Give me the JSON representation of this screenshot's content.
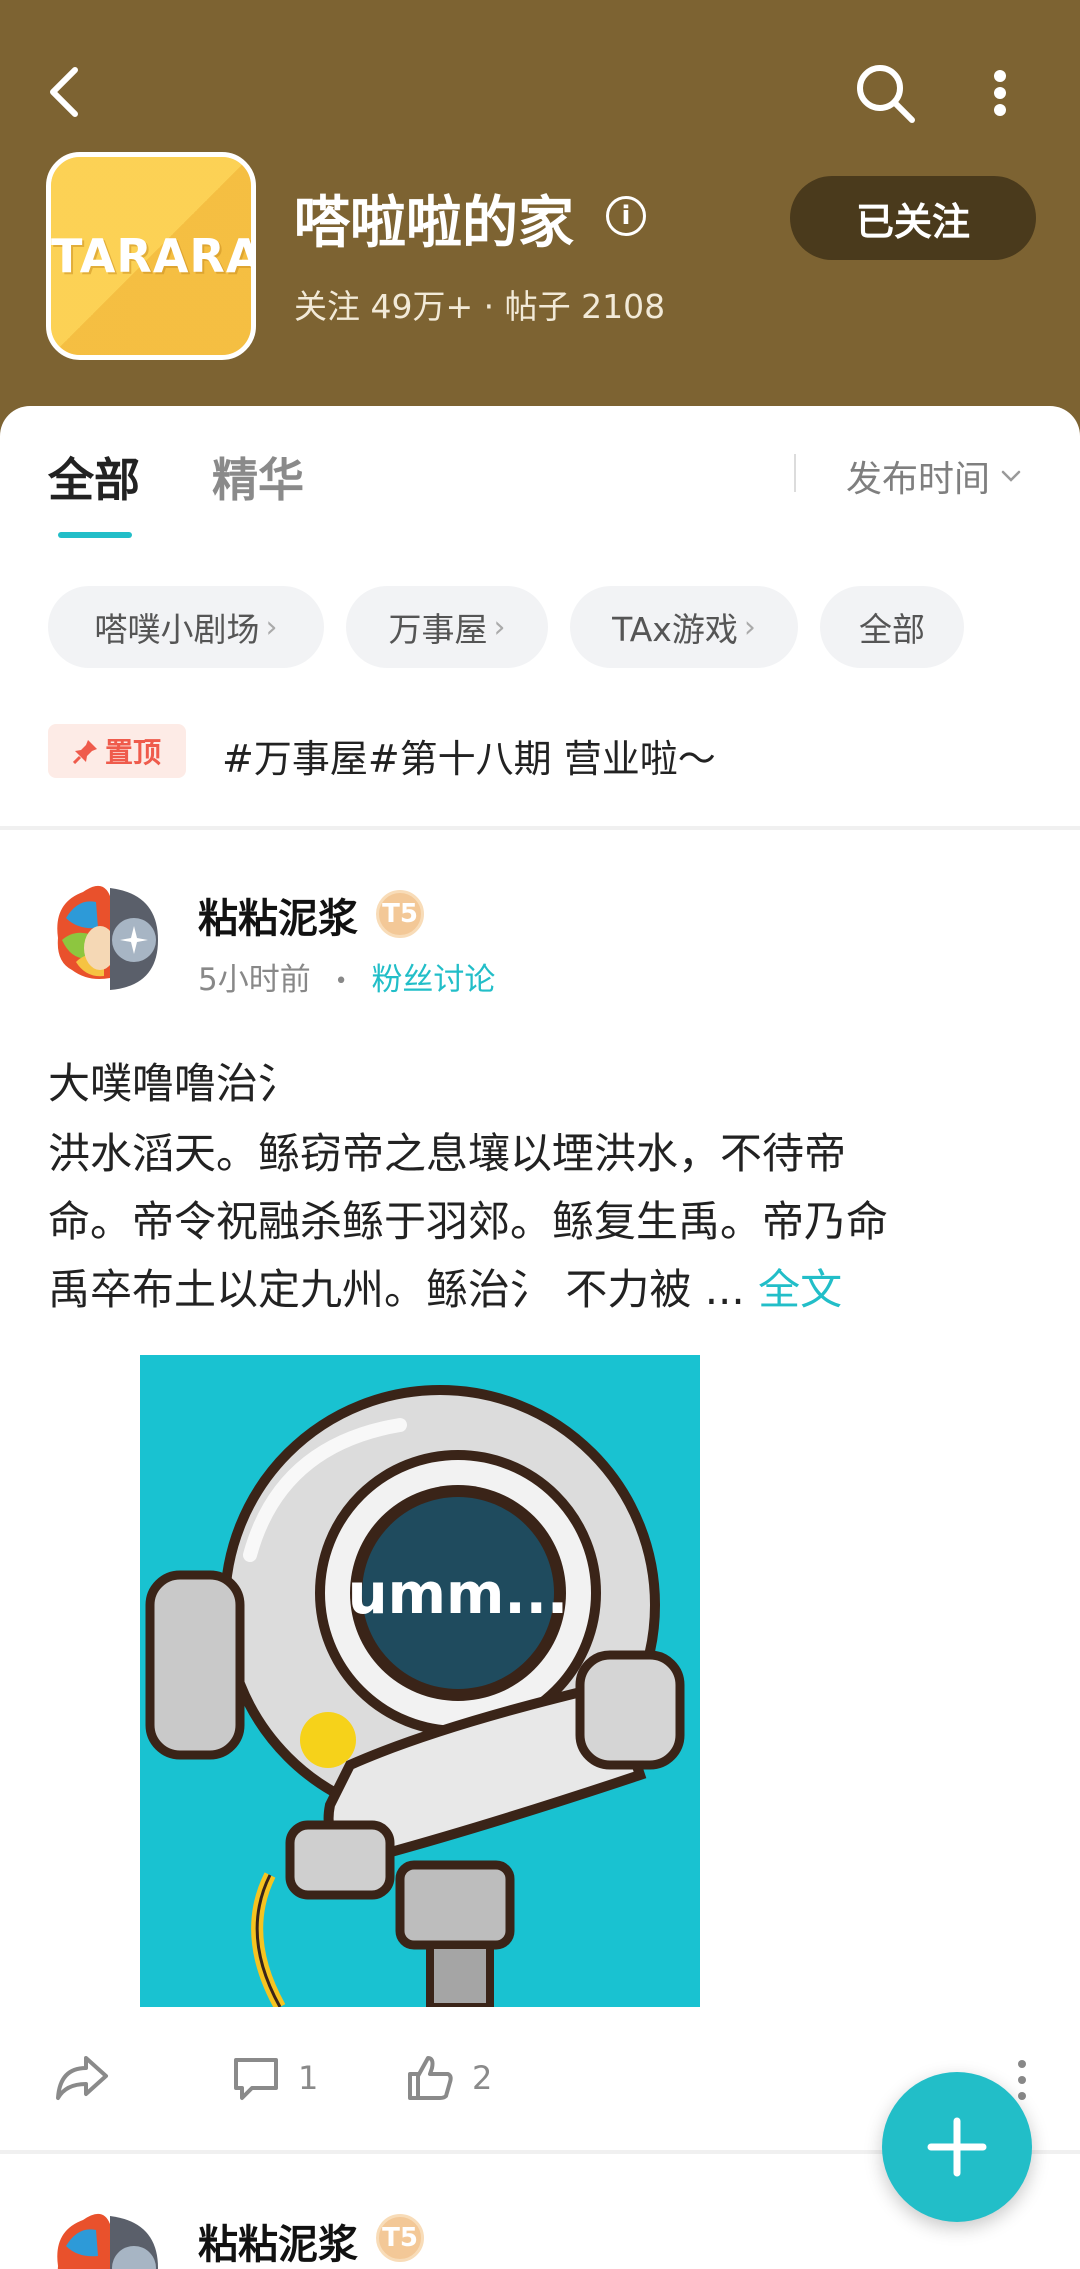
{
  "colors": {
    "header_bg": "#7d6332",
    "accent": "#22bec8",
    "pin_red": "#ef5b4c"
  },
  "header": {
    "logo_text": "TARARA",
    "title": "嗒啦啦的家",
    "stats": "关注 49万+ · 帖子 2108",
    "follow_label": "已关注"
  },
  "icons": [
    "back-icon",
    "search-icon",
    "more-vertical-icon",
    "info-icon",
    "pin-icon",
    "share-icon",
    "comment-icon",
    "like-icon",
    "plus-icon"
  ],
  "tabs": [
    {
      "label": "全部",
      "active": true
    },
    {
      "label": "精华",
      "active": false
    }
  ],
  "sort": {
    "label": "发布时间"
  },
  "chips": [
    {
      "label": "嗒噗小剧场"
    },
    {
      "label": "万事屋"
    },
    {
      "label": "TAx游戏"
    },
    {
      "label": "全部"
    }
  ],
  "pinned": {
    "badge": "置顶",
    "text": "#万事屋#第十八期 营业啦～"
  },
  "post": {
    "author": "粘粘泥浆",
    "badge": "T5",
    "time": "5小时前",
    "dot": "•",
    "category": "粉丝讨论",
    "title": "大噗噜噜治氵",
    "body_lines": [
      "洪水滔天。鲧窃帝之息壤以堙洪水，不待帝",
      "命。帝令祝融杀鲧于羽郊。鲧复生禹。帝乃命",
      "禹卒布土以定九州。鲧治氵 不力被 ... "
    ],
    "full_text_label": "全文",
    "image_text": "umm...",
    "comments": "1",
    "likes": "2"
  },
  "next_post": {
    "author": "粘粘泥浆",
    "badge": "T5"
  }
}
